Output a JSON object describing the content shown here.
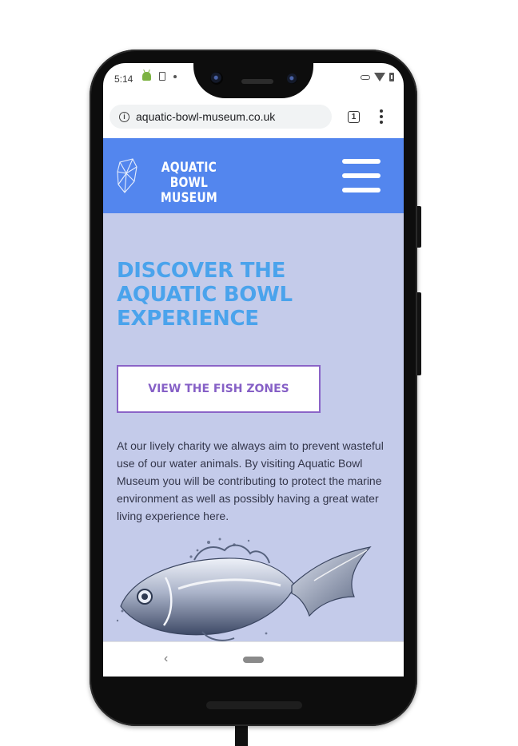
{
  "status_bar": {
    "time": "5:14",
    "icons_left": [
      "android-icon",
      "download-icon",
      "dot-icon"
    ],
    "icons_right": [
      "vpn-key-icon",
      "wifi-icon",
      "battery-icon"
    ]
  },
  "browser": {
    "url": "aquatic-bowl-museum.co.uk",
    "tab_count": "1",
    "info_icon_glyph": "i"
  },
  "site": {
    "logo_line1": "AQUATIC BOWL",
    "logo_line2": "MUSEUM",
    "header_color": "#5386ee"
  },
  "hero": {
    "title_line1": "DISCOVER THE",
    "title_line2": "AQUATIC BOWL",
    "title_line3": "EXPERIENCE",
    "cta_label": "VIEW THE FISH ZONES",
    "intro": "At our lively charity we always aim to prevent wasteful use of our water animals. By visiting Aquatic Bowl Museum you will be contributing to protect the marine environment as well as possibly having a great water living experience here.",
    "background_color": "#c4cbea",
    "title_color": "#4aa3ec",
    "cta_color": "#8660c6"
  },
  "nav_bar": {
    "back_glyph": "‹"
  }
}
